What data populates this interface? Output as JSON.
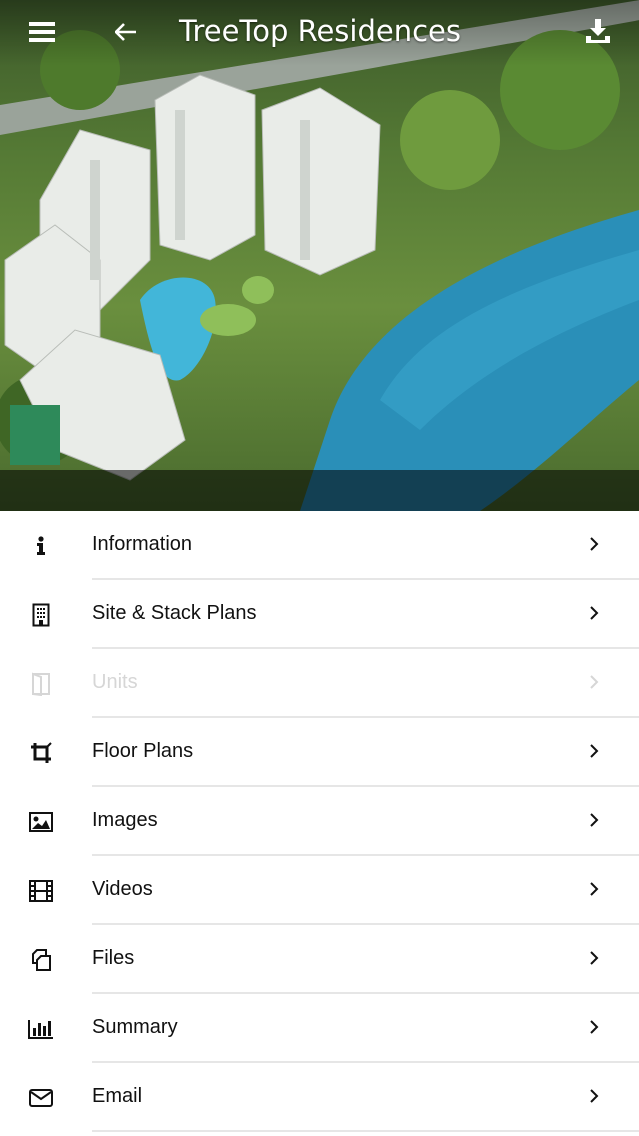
{
  "header": {
    "title": "TreeTop Residences",
    "menu_icon": "hamburger-menu-icon",
    "back_icon": "arrow-left-icon",
    "download_icon": "download-icon"
  },
  "hero": {
    "image": "aerial rendering of condominium towers beside a lake"
  },
  "menu": [
    {
      "label": "Information",
      "icon": "info-icon",
      "enabled": true
    },
    {
      "label": "Site & Stack Plans",
      "icon": "building-icon",
      "enabled": true
    },
    {
      "label": "Units",
      "icon": "door-icon",
      "enabled": false
    },
    {
      "label": "Floor Plans",
      "icon": "crop-icon",
      "enabled": true
    },
    {
      "label": "Images",
      "icon": "image-icon",
      "enabled": true
    },
    {
      "label": "Videos",
      "icon": "film-icon",
      "enabled": true
    },
    {
      "label": "Files",
      "icon": "files-icon",
      "enabled": true
    },
    {
      "label": "Summary",
      "icon": "bar-chart-icon",
      "enabled": true
    },
    {
      "label": "Email",
      "icon": "envelope-icon",
      "enabled": true
    }
  ],
  "colors": {
    "text": "#111111",
    "disabled": "#d6d6d6",
    "separator": "#e6e6e6",
    "lake": "#2a8fb8"
  }
}
